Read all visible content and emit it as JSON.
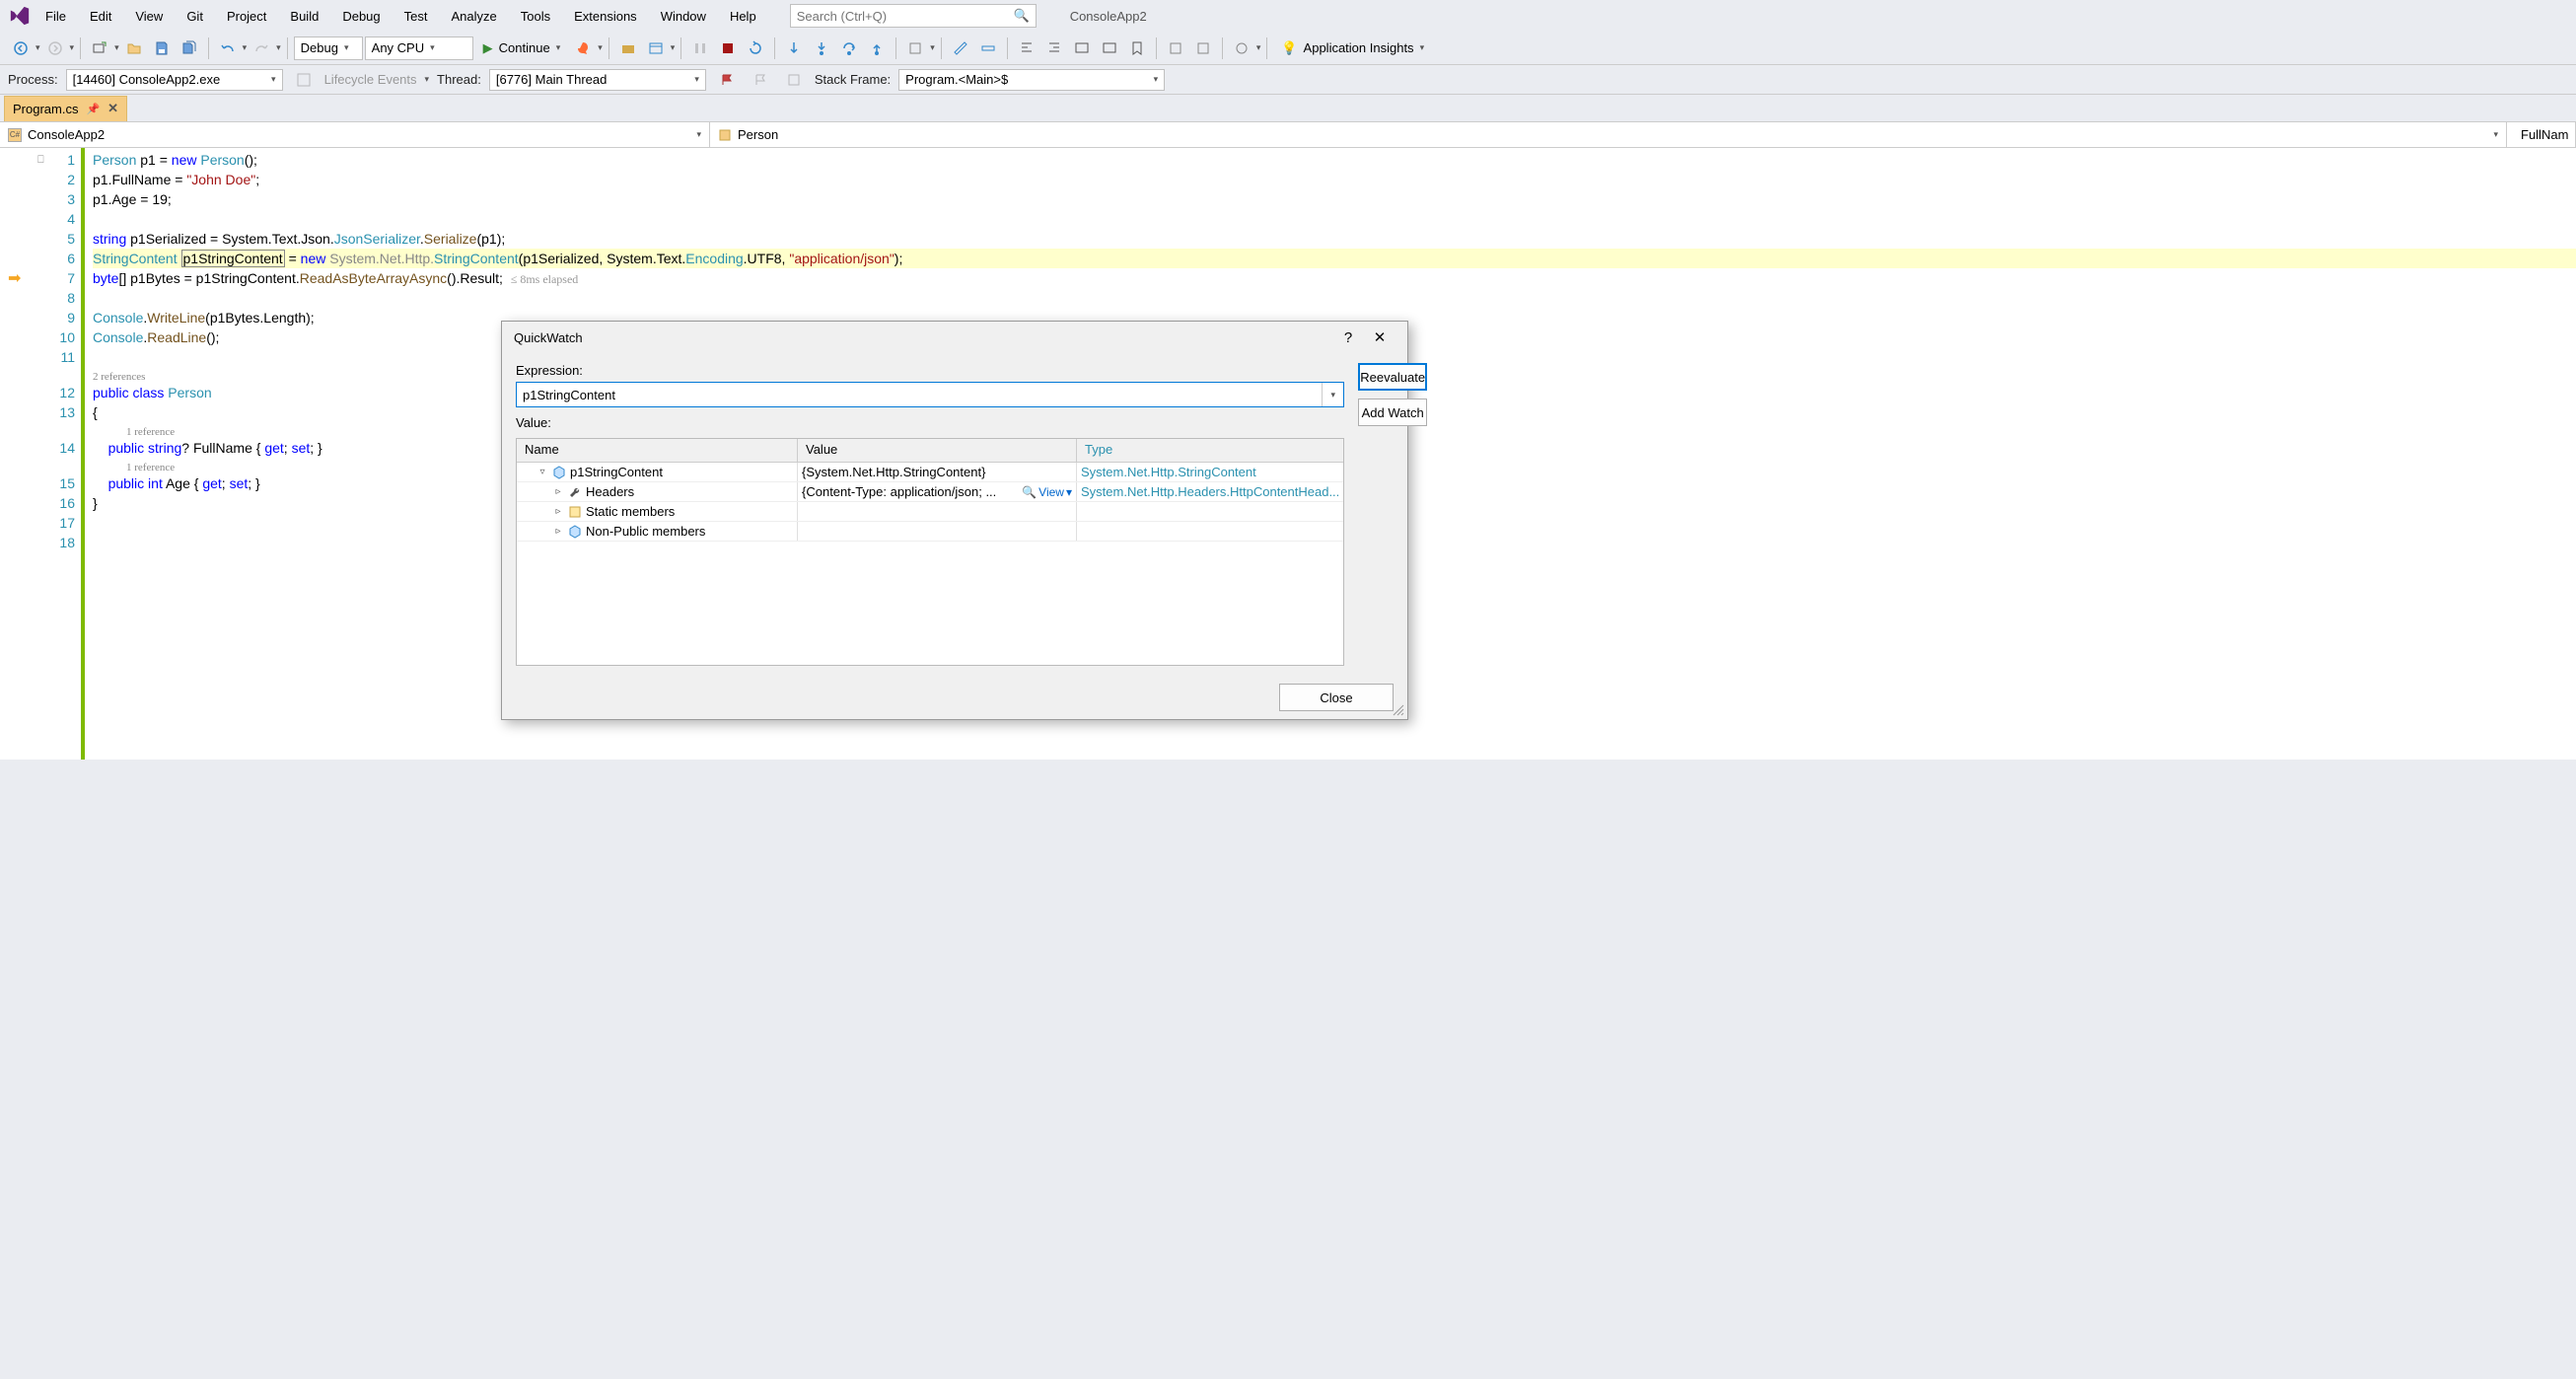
{
  "menu": {
    "items": [
      "File",
      "Edit",
      "View",
      "Git",
      "Project",
      "Build",
      "Debug",
      "Test",
      "Analyze",
      "Tools",
      "Extensions",
      "Window",
      "Help"
    ],
    "search_placeholder": "Search (Ctrl+Q)",
    "solution": "ConsoleApp2"
  },
  "toolbar": {
    "config": "Debug",
    "platform": "Any CPU",
    "continue": "Continue",
    "insights": "Application Insights"
  },
  "debugbar": {
    "process_label": "Process:",
    "process_value": "[14460] ConsoleApp2.exe",
    "lifecycle": "Lifecycle Events",
    "thread_label": "Thread:",
    "thread_value": "[6776] Main Thread",
    "stack_label": "Stack Frame:",
    "stack_value": "Program.<Main>$"
  },
  "tab": {
    "name": "Program.cs"
  },
  "navbar": {
    "project": "ConsoleApp2",
    "scope": "Person",
    "member": "FullNam"
  },
  "code": {
    "line_numbers": [
      "1",
      "2",
      "3",
      "4",
      "5",
      "6",
      "7",
      "8",
      "9",
      "10",
      "11",
      "12",
      "13",
      "14",
      "15",
      "16",
      "17",
      "18"
    ],
    "elapsed": "≤ 8ms elapsed",
    "codelens1": "2 references",
    "codelens2": "1 reference",
    "codelens3": "1 reference"
  },
  "quickwatch": {
    "title": "QuickWatch",
    "expression_label": "Expression:",
    "expression_value": "p1StringContent",
    "value_label": "Value:",
    "reevaluate": "Reevaluate",
    "addwatch": "Add Watch",
    "close": "Close",
    "columns": {
      "name": "Name",
      "value": "Value",
      "type": "Type"
    },
    "rows": [
      {
        "indent": 0,
        "expander": "▿",
        "icon": "cube",
        "name": "p1StringContent",
        "value": "{System.Net.Http.StringContent}",
        "type": "System.Net.Http.StringContent"
      },
      {
        "indent": 1,
        "expander": "▹",
        "icon": "wrench",
        "name": "Headers",
        "value": "{Content-Type: application/json; ...",
        "viewlink": "View",
        "type": "System.Net.Http.Headers.HttpContentHead..."
      },
      {
        "indent": 1,
        "expander": "▹",
        "icon": "struct",
        "name": "Static members",
        "value": "",
        "type": ""
      },
      {
        "indent": 1,
        "expander": "▹",
        "icon": "cube",
        "name": "Non-Public members",
        "value": "",
        "type": ""
      }
    ]
  }
}
